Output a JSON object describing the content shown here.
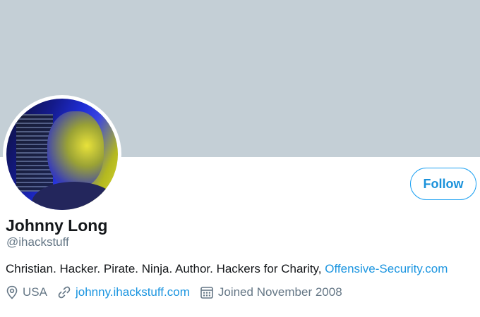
{
  "profile": {
    "name": "Johnny Long",
    "handle": "@ihackstuff",
    "bio_text": "Christian. Hacker. Pirate. Ninja. Author. Hackers for Charity, ",
    "bio_link": "Offensive-Security.com",
    "location": "USA",
    "website": "johnny.ihackstuff.com",
    "joined": "Joined November 2008"
  },
  "actions": {
    "follow_label": "Follow"
  },
  "icons": {
    "location": "location-pin-icon",
    "website": "link-icon",
    "joined": "calendar-icon"
  },
  "colors": {
    "banner": "#c4cfd6",
    "accent": "#1da1f2",
    "link": "#1b95e0",
    "secondary_text": "#657786"
  }
}
